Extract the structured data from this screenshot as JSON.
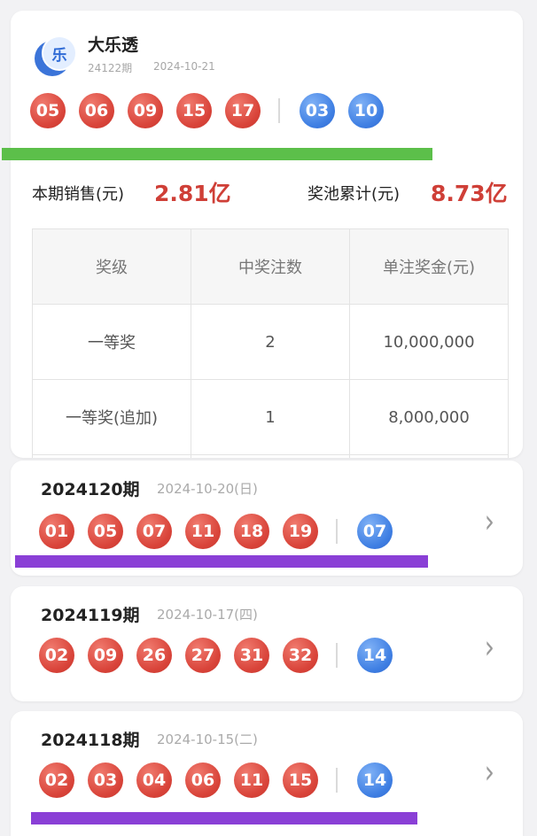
{
  "lottery": {
    "name": "大乐透",
    "logo_char": "乐",
    "issue": "24122期",
    "date": "2024-10-21",
    "red_balls": [
      "05",
      "06",
      "09",
      "15",
      "17"
    ],
    "blue_balls": [
      "03",
      "10"
    ],
    "sales_label": "本期销售(元)",
    "sales_value": "2.81亿",
    "pool_label": "奖池累计(元)",
    "pool_value": "8.73亿"
  },
  "prize_table": {
    "headers": [
      "奖级",
      "中奖注数",
      "单注奖金(元)"
    ],
    "rows": [
      [
        "一等奖",
        "2",
        "10,000,000"
      ],
      [
        "一等奖(追加)",
        "1",
        "8,000,000"
      ]
    ]
  },
  "history": [
    {
      "issue": "2024120期",
      "date": "2024-10-20(日)",
      "red_balls": [
        "01",
        "05",
        "07",
        "11",
        "18",
        "19"
      ],
      "blue_balls": [
        "07"
      ]
    },
    {
      "issue": "2024119期",
      "date": "2024-10-17(四)",
      "red_balls": [
        "02",
        "09",
        "26",
        "27",
        "31",
        "32"
      ],
      "blue_balls": [
        "14"
      ]
    },
    {
      "issue": "2024118期",
      "date": "2024-10-15(二)",
      "red_balls": [
        "02",
        "03",
        "04",
        "06",
        "11",
        "15"
      ],
      "blue_balls": [
        "14"
      ]
    }
  ],
  "colors": {
    "accent_red": "#cf3f37",
    "ball_red": "#d9443a",
    "ball_blue": "#3f7fe3",
    "highlight_green": "#5cbf4a",
    "highlight_purple": "#8a3fd6"
  }
}
